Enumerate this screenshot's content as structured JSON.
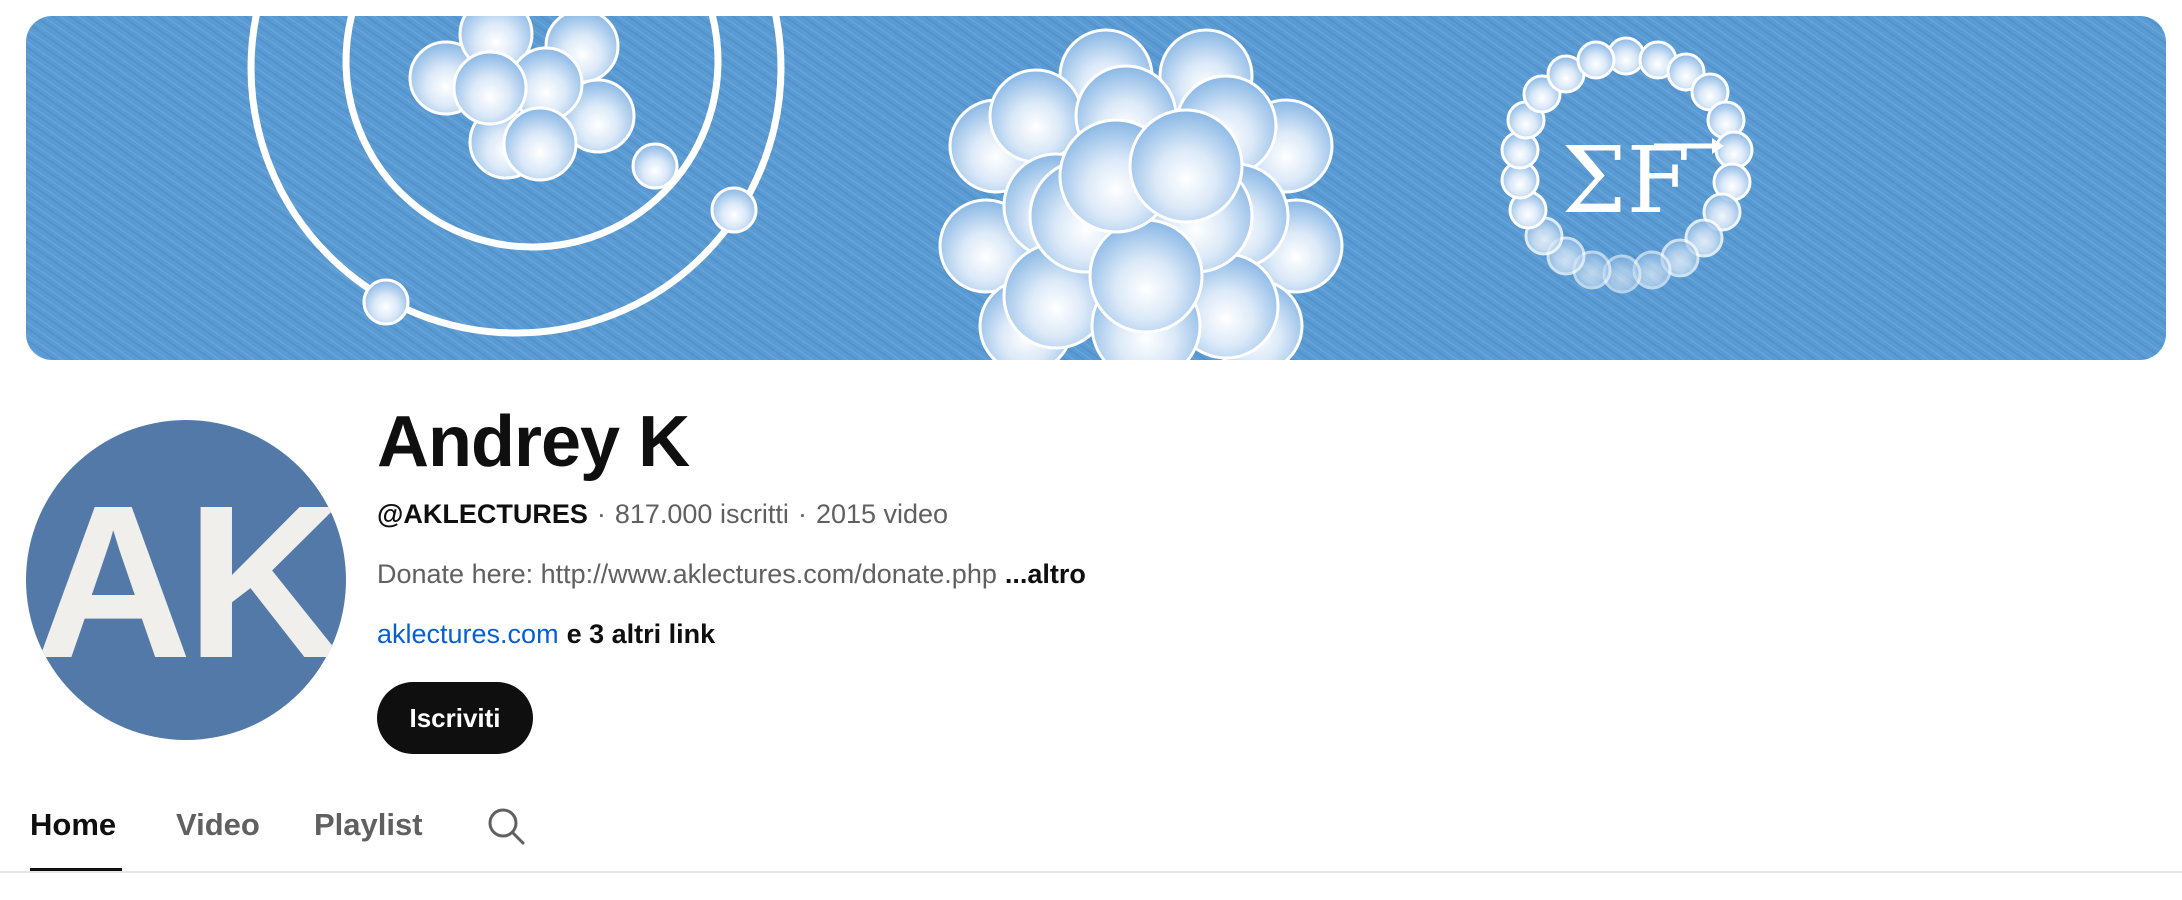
{
  "channel": {
    "name": "Andrey K",
    "handle": "@AKLECTURES",
    "subscribers": "817.000 iscritti",
    "videos": "2015 video",
    "meta_separator": "·",
    "description": "Donate here: http://www.aklectures.com/donate.php",
    "description_more": "...altro",
    "link_primary": "aklectures.com",
    "link_others": "e 3 altri link",
    "subscribe_label": "Iscriviti",
    "avatar_initials": "AK"
  },
  "banner": {
    "formula": "ΣF",
    "background_color": "#5b9bd3",
    "accent_color": "#ffffff"
  },
  "avatar": {
    "background_color": "#5279a8",
    "text_color": "#f1efeb"
  },
  "tabs": [
    {
      "label": "Home",
      "active": true
    },
    {
      "label": "Video",
      "active": false
    },
    {
      "label": "Playlist",
      "active": false
    }
  ],
  "icons": {
    "tab_search": "search-icon"
  },
  "colors": {
    "primary_text": "#0f0f0f",
    "secondary_text": "#606060",
    "link": "#065fd4",
    "button_bg": "#0f0f0f",
    "button_text": "#ffffff"
  }
}
